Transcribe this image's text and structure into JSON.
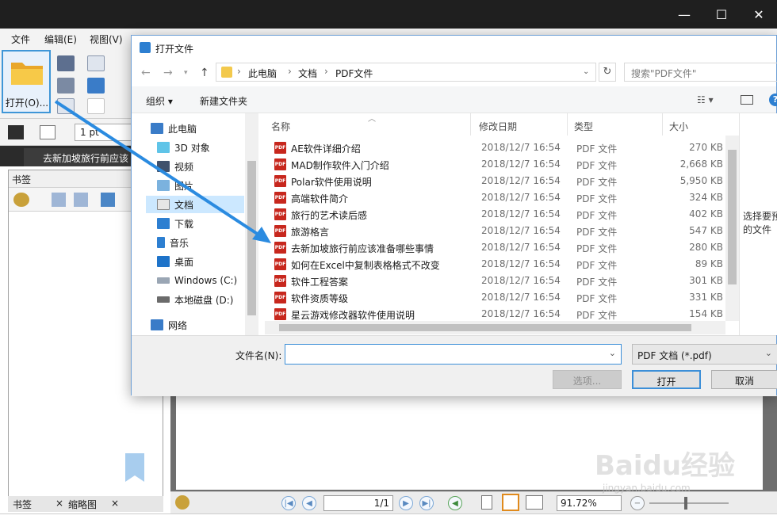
{
  "app": {
    "menu": [
      "文件",
      "编辑(E)",
      "视图(V)"
    ],
    "open_label": "打开(O)...",
    "line_width": "1 pt",
    "tab_title": "去新加坡旅行前应该",
    "bookmark_panel_title": "书签",
    "bottom_tabs": [
      "书签",
      "缩略图"
    ],
    "page_indicator": "1/1",
    "zoom": "91.72%",
    "watermark": "Baidu经验",
    "watermark_sub": "jingyan.baidu.com"
  },
  "dialog": {
    "title": "打开文件",
    "breadcrumb": [
      "此电脑",
      "文档",
      "PDF文件"
    ],
    "search_placeholder": "搜索\"PDF文件\"",
    "organize": "组织",
    "new_folder": "新建文件夹",
    "nav_items": [
      {
        "label": "此电脑",
        "icon": "computer-icon"
      },
      {
        "label": "3D 对象",
        "icon": "cube-icon"
      },
      {
        "label": "视频",
        "icon": "video-icon"
      },
      {
        "label": "图片",
        "icon": "image-icon"
      },
      {
        "label": "文档",
        "icon": "document-icon"
      },
      {
        "label": "下载",
        "icon": "download-icon"
      },
      {
        "label": "音乐",
        "icon": "music-icon"
      },
      {
        "label": "桌面",
        "icon": "desktop-icon"
      },
      {
        "label": "Windows (C:)",
        "icon": "drive-icon"
      },
      {
        "label": "本地磁盘 (D:)",
        "icon": "drive-icon"
      },
      {
        "label": "网络",
        "icon": "network-icon"
      }
    ],
    "columns": [
      "名称",
      "修改日期",
      "类型",
      "大小"
    ],
    "files": [
      {
        "name": "AE软件详细介绍",
        "date": "2018/12/7 16:54",
        "type": "PDF 文件",
        "size": "270 KB"
      },
      {
        "name": "MAD制作软件入门介绍",
        "date": "2018/12/7 16:54",
        "type": "PDF 文件",
        "size": "2,668 KB"
      },
      {
        "name": "Polar软件使用说明",
        "date": "2018/12/7 16:54",
        "type": "PDF 文件",
        "size": "5,950 KB"
      },
      {
        "name": "高端软件简介",
        "date": "2018/12/7 16:54",
        "type": "PDF 文件",
        "size": "324 KB"
      },
      {
        "name": "旅行的艺术读后感",
        "date": "2018/12/7 16:54",
        "type": "PDF 文件",
        "size": "402 KB"
      },
      {
        "name": "旅游格言",
        "date": "2018/12/7 16:54",
        "type": "PDF 文件",
        "size": "547 KB"
      },
      {
        "name": "去新加坡旅行前应该准备哪些事情",
        "date": "2018/12/7 16:54",
        "type": "PDF 文件",
        "size": "280 KB"
      },
      {
        "name": "如何在Excel中复制表格格式不改变",
        "date": "2018/12/7 16:54",
        "type": "PDF 文件",
        "size": "89 KB"
      },
      {
        "name": "软件工程答案",
        "date": "2018/12/7 16:54",
        "type": "PDF 文件",
        "size": "301 KB"
      },
      {
        "name": "软件资质等级",
        "date": "2018/12/7 16:54",
        "type": "PDF 文件",
        "size": "331 KB"
      },
      {
        "name": "星云游戏修改器软件使用说明",
        "date": "2018/12/7 16:54",
        "type": "PDF 文件",
        "size": "154 KB"
      }
    ],
    "preview_text": "选择要预\n的文件",
    "filename_label": "文件名(N):",
    "filename_value": "",
    "filetype": "PDF 文档 (*.pdf)",
    "btn_options": "选项...",
    "btn_open": "打开",
    "btn_cancel": "取消",
    "pdf_badge": "PDF"
  },
  "colors": {
    "accent": "#3c8fd8",
    "pdf_red": "#c7271d",
    "selection": "#cce8ff",
    "titlebar_dark": "#1f1f1f"
  }
}
